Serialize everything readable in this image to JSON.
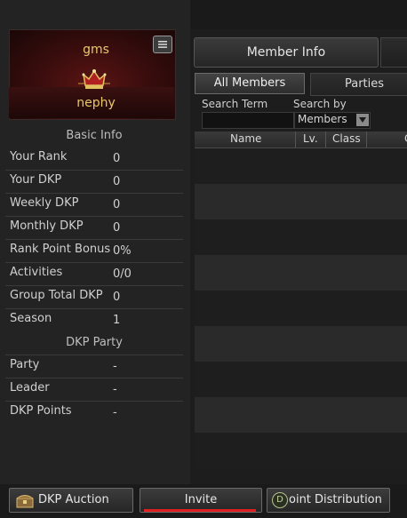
{
  "guild": {
    "name": "gms"
  },
  "player": {
    "name": "nephy"
  },
  "sections": {
    "basic_info": "Basic Info",
    "dkp_party": "DKP Party"
  },
  "basic_info": [
    {
      "label": "Your Rank",
      "value": "0"
    },
    {
      "label": "Your DKP",
      "value": "0"
    },
    {
      "label": "Weekly DKP",
      "value": "0"
    },
    {
      "label": "Monthly DKP",
      "value": "0"
    },
    {
      "label": "Rank Point Bonus",
      "value": "0%"
    },
    {
      "label": "Activities",
      "value": "0/0"
    },
    {
      "label": "Group Total DKP",
      "value": "0"
    },
    {
      "label": "Season",
      "value": "1"
    }
  ],
  "dkp_party": [
    {
      "label": "Party",
      "value": "-"
    },
    {
      "label": "Leader",
      "value": "-"
    },
    {
      "label": "DKP Points",
      "value": "-"
    }
  ],
  "tabs": {
    "member_info": "Member Info"
  },
  "subtabs": {
    "all_members": "All Members",
    "parties": "Parties"
  },
  "search": {
    "term_label": "Search Term",
    "term_value": "",
    "by_label": "Search by",
    "by_value": "Members"
  },
  "columns": [
    "Name",
    "Lv.",
    "Class",
    "C"
  ],
  "buttons": {
    "auction": "DKP Auction",
    "invite": "Invite",
    "distribution": "oint Distribution",
    "distribution_icon_letter": "D"
  },
  "colors": {
    "gold": "#e8c86a",
    "accent_red": "#e02020"
  },
  "icons": [
    "menu-icon",
    "crown-icon",
    "chevron-down-icon",
    "auction-chest-icon",
    "dkp-coin-icon"
  ]
}
